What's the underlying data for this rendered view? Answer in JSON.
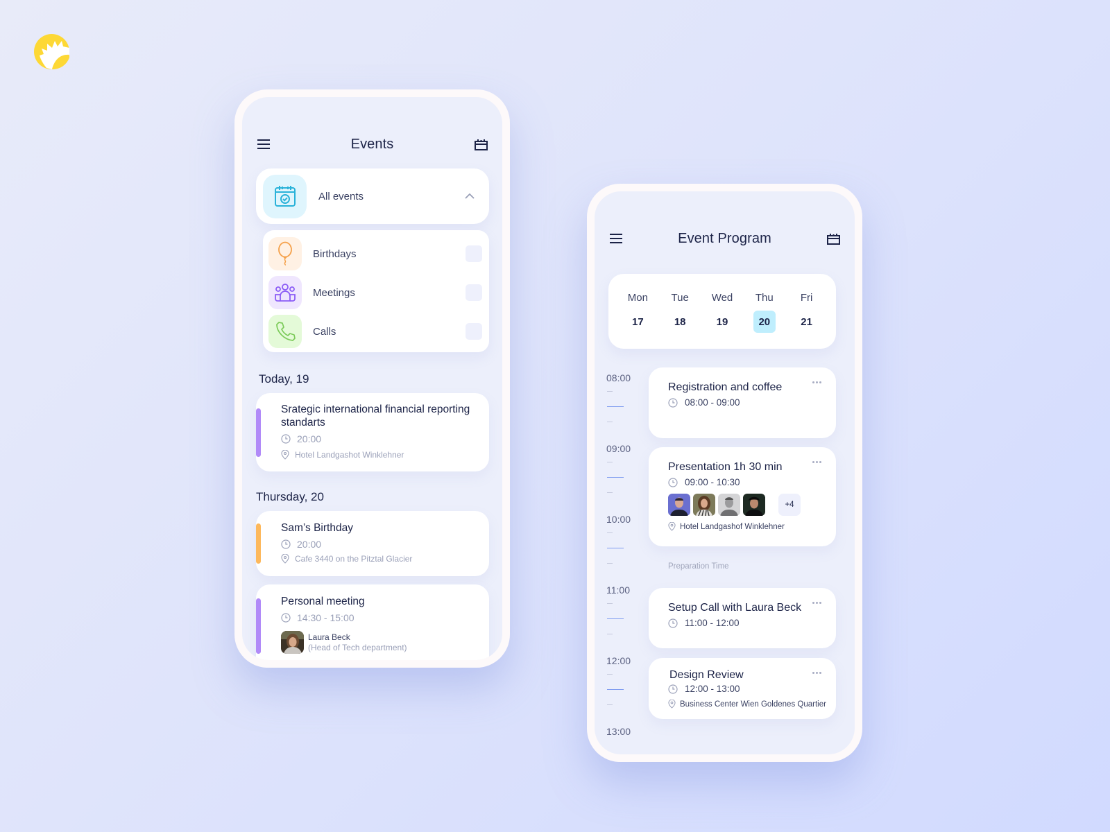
{
  "brand": {
    "logo": "sun-logo-icon",
    "accent": "#fdd835"
  },
  "events_screen": {
    "title": "Events",
    "menu_icon": "hamburger-menu-icon",
    "calendar_icon": "calendar-icon",
    "dropdown": {
      "label": "All events",
      "icon": "calendar-check-icon",
      "expanded": true
    },
    "filters": [
      {
        "label": "Birthdays",
        "icon": "balloon-icon",
        "color": "#f5a14a",
        "bg": "#fff1e4",
        "checked": false
      },
      {
        "label": "Meetings",
        "icon": "group-icon",
        "color": "#8b5cf6",
        "bg": "#efe6fe",
        "checked": false
      },
      {
        "label": "Calls",
        "icon": "phone-icon",
        "color": "#7ccb5a",
        "bg": "#e4fad8",
        "checked": false
      }
    ],
    "sections": [
      {
        "day": "Today, 19",
        "events": [
          {
            "title": "Srategic international financial reporting standarts",
            "time": "20:00",
            "location": "Hotel Landgashot Winklehner",
            "color": "#b18af8"
          }
        ]
      },
      {
        "day": "Thursday, 20",
        "events": [
          {
            "title": "Sam’s Birthday",
            "time": "20:00",
            "location": "Cafe 3440 on the Pitztal Glacier",
            "color": "#fdb85c"
          },
          {
            "title": "Personal meeting",
            "time": "14:30 - 15:00",
            "person_name": "Laura Beck",
            "person_role": "(Head of Tech department)",
            "color": "#b18af8"
          }
        ]
      }
    ]
  },
  "program_screen": {
    "title": "Event Program",
    "menu_icon": "hamburger-menu-icon",
    "calendar_icon": "calendar-icon",
    "week": [
      {
        "day": "Mon",
        "date": "17",
        "active": false
      },
      {
        "day": "Tue",
        "date": "18",
        "active": false
      },
      {
        "day": "Wed",
        "date": "19",
        "active": false
      },
      {
        "day": "Thu",
        "date": "20",
        "active": true
      },
      {
        "day": "Fri",
        "date": "21",
        "active": false
      }
    ],
    "hours": [
      "08:00",
      "09:00",
      "10:00",
      "11:00",
      "12:00",
      "13:00"
    ],
    "items": [
      {
        "title": "Registration and coffee",
        "time": "08:00 - 09:00"
      },
      {
        "title": "Presentation 1h 30 min",
        "time": "09:00 - 10:30",
        "attendees_extra": "+4",
        "location": "Hotel Landgashof Winklehner"
      },
      {
        "title": "Setup Call with Laura Beck",
        "time": "11:00 - 12:00"
      },
      {
        "title": "Design Review",
        "time": "12:00 - 13:00",
        "location": "Business Center Wien Goldenes Quartier"
      }
    ],
    "preparation_label": "Preparation Time"
  }
}
